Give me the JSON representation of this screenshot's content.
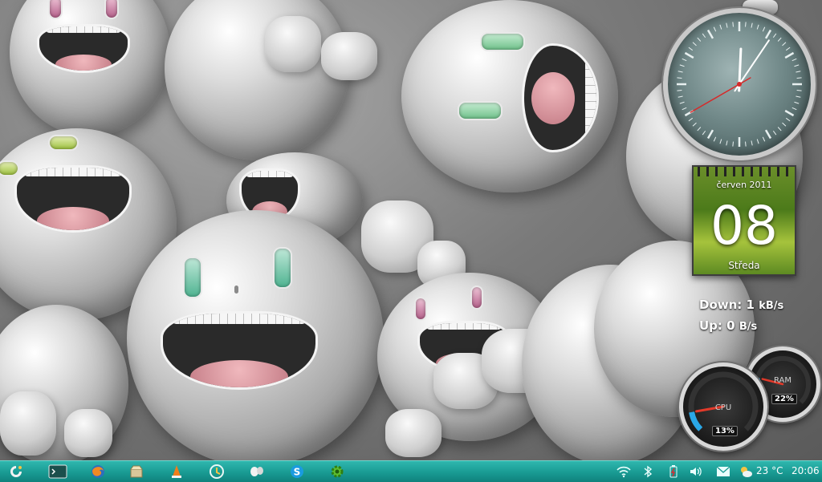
{
  "widgets": {
    "clock": {
      "hour": 12,
      "minute": 5,
      "second": 40
    },
    "calendar": {
      "month": "červen 2011",
      "day": "08",
      "weekday": "Středa"
    },
    "network": {
      "down_label": "Down:",
      "down_value": "1",
      "down_unit": "kB/s",
      "up_label": "Up:",
      "up_value": "0",
      "up_unit": "B/s"
    },
    "gauges": {
      "cpu_label": "CPU",
      "cpu_value": "13%",
      "cpu_level": 0.13,
      "ram_label": "RAM",
      "ram_value": "22%",
      "ram_level": 0.22
    }
  },
  "taskbar": {
    "launchers": [
      {
        "name": "app-menu-icon"
      },
      {
        "name": "terminal-icon"
      },
      {
        "name": "firefox-icon"
      },
      {
        "name": "package-installer-icon"
      },
      {
        "name": "vlc-icon"
      },
      {
        "name": "update-manager-icon"
      },
      {
        "name": "chat-icon"
      },
      {
        "name": "skype-icon"
      },
      {
        "name": "settings-gear-icon"
      }
    ],
    "tray": {
      "temperature": "23 °C",
      "time": "20:06"
    }
  },
  "colors": {
    "taskbar": "#199a93",
    "calendar_green": "#6b8f2a",
    "clock_second_hand": "#d62a2a"
  }
}
